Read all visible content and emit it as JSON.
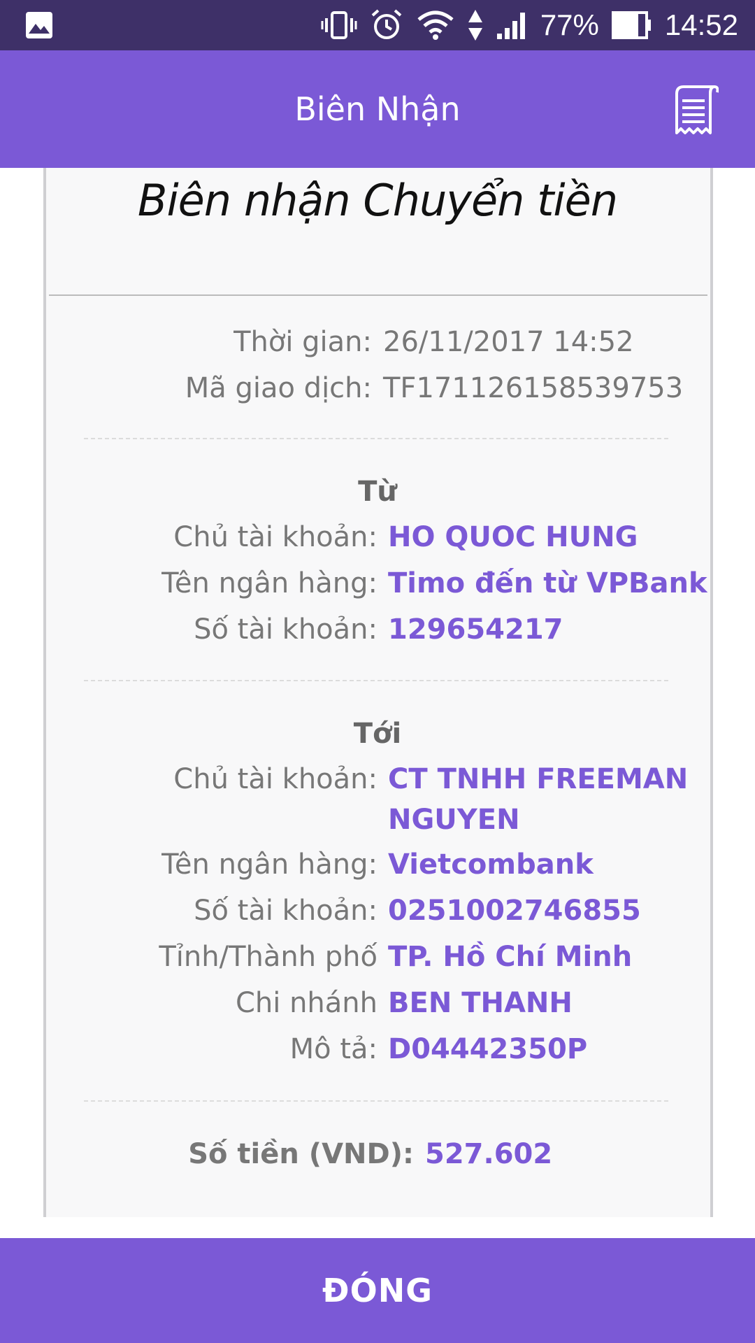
{
  "status_bar": {
    "battery": "77%",
    "time": "14:52",
    "icons": [
      "image-icon",
      "vibrate-icon",
      "alarm-icon",
      "wifi-icon",
      "data-arrows-icon",
      "signal-icon",
      "battery-icon"
    ]
  },
  "app_bar": {
    "title": "Biên Nhận",
    "action_icon": "receipt-icon"
  },
  "receipt": {
    "title": "Biên nhận Chuyển tiền",
    "meta": [
      {
        "label": "Thời gian:",
        "value": "26/11/2017 14:52"
      },
      {
        "label": "Mã giao dịch:",
        "value": "TF171126158539753"
      }
    ],
    "from": {
      "heading": "Từ",
      "fields": [
        {
          "label": "Chủ tài khoản:",
          "value": "HO QUOC HUNG"
        },
        {
          "label": "Tên ngân hàng:",
          "value": "Timo đến từ VPBank"
        },
        {
          "label": "Số tài khoản:",
          "value": "129654217"
        }
      ]
    },
    "to": {
      "heading": "Tới",
      "account_holder": {
        "label": "Chủ tài khoản:",
        "value_line1": "CT TNHH FREEMAN",
        "value_line2": "NGUYEN"
      },
      "fields": [
        {
          "label": "Tên ngân hàng:",
          "value": "Vietcombank"
        },
        {
          "label": "Số tài khoản:",
          "value": "0251002746855"
        },
        {
          "label": "Tỉnh/Thành phố",
          "value": "TP. Hồ Chí Minh"
        },
        {
          "label": "Chi nhánh",
          "value": "BEN THANH"
        },
        {
          "label": "Mô tả:",
          "value": "D04442350P"
        }
      ]
    },
    "amount": {
      "label": "Số tiền (VND):",
      "value": "527.602"
    }
  },
  "close_button": {
    "label": "ĐÓNG"
  },
  "colors": {
    "accent": "#7b59d6",
    "status_bar": "#3e3068",
    "card_bg": "#f8f8f9",
    "label_text": "#777777"
  }
}
